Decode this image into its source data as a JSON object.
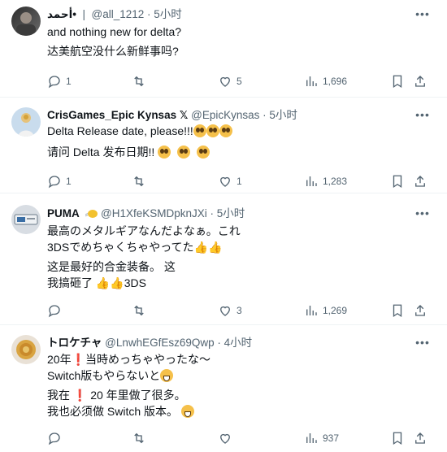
{
  "tweets": [
    {
      "name": "أحمد•",
      "handle": "@all_1212",
      "time": "5小时",
      "line1": "and nothing new for delta?",
      "line2": "达美航空没什么新鲜事吗?",
      "replies": "1",
      "likes": "5",
      "views": "1,696"
    },
    {
      "name": "CrisGames_Epic Kynsas",
      "handle": "@EpicKynsas",
      "time": "5小时",
      "line1": "Delta Release date, please!!!",
      "line2": "请问 Delta 发布日期!!",
      "replies": "1",
      "likes": "1",
      "views": "1,283"
    },
    {
      "name": "PUMA",
      "handle": "@H1XfeKSMDpknJXi",
      "time": "5小时",
      "line1": "最高のメタルギアなんだよなぁ。これ",
      "line2": "3DSでめちゃくちゃやってた",
      "line3": "这是最好的合金装备。 这",
      "line4": "我搞砸了",
      "line4_end": "3DS",
      "likes": "3",
      "views": "1,269"
    },
    {
      "name": "トロケチャ",
      "handle": "@LnwhEGfEsz69Qwp",
      "time": "4小时",
      "line1_a": "20年",
      "line1_b": "当時めっちゃやったな〜",
      "line2": "Switch版もやらないと",
      "line3_a": "我在",
      "line3_b": "20 年里做了很多。",
      "line4": "我也必须做 Switch 版本。",
      "views": "937"
    }
  ],
  "icons": {
    "more": "more-icon",
    "reply": "reply-icon",
    "retweet": "retweet-icon",
    "like": "like-icon",
    "views": "views-icon",
    "bookmark": "bookmark-icon",
    "share": "share-icon"
  },
  "colors": {
    "text": "#0f1419",
    "secondary": "#536471",
    "divider": "#eff3f4"
  }
}
